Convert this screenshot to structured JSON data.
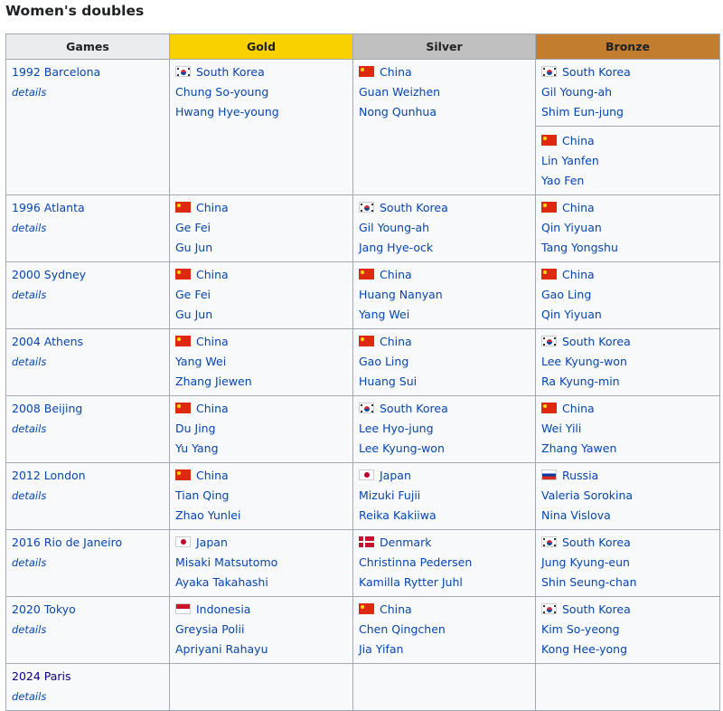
{
  "title": "Women's doubles",
  "headers": {
    "games": "Games",
    "gold": "Gold",
    "silver": "Silver",
    "bronze": "Bronze"
  },
  "details_label": "details",
  "rows": [
    {
      "games": "1992 Barcelona",
      "gold": {
        "country": "South Korea",
        "flag": "kr",
        "players": [
          "Chung So-young",
          "Hwang Hye-young"
        ]
      },
      "silver": {
        "country": "China",
        "flag": "cn",
        "players": [
          "Guan Weizhen",
          "Nong Qunhua"
        ]
      },
      "bronze": {
        "country": "South Korea",
        "flag": "kr",
        "players": [
          "Gil Young-ah",
          "Shim Eun-jung"
        ]
      },
      "bronze2": {
        "country": "China",
        "flag": "cn",
        "players": [
          "Lin Yanfen",
          "Yao Fen"
        ]
      }
    },
    {
      "games": "1996 Atlanta",
      "gold": {
        "country": "China",
        "flag": "cn",
        "players": [
          "Ge Fei",
          "Gu Jun"
        ]
      },
      "silver": {
        "country": "South Korea",
        "flag": "kr",
        "players": [
          "Gil Young-ah",
          "Jang Hye-ock"
        ]
      },
      "bronze": {
        "country": "China",
        "flag": "cn",
        "players": [
          "Qin Yiyuan",
          "Tang Yongshu"
        ]
      }
    },
    {
      "games": "2000 Sydney",
      "gold": {
        "country": "China",
        "flag": "cn",
        "players": [
          "Ge Fei",
          "Gu Jun"
        ]
      },
      "silver": {
        "country": "China",
        "flag": "cn",
        "players": [
          "Huang Nanyan",
          "Yang Wei"
        ]
      },
      "bronze": {
        "country": "China",
        "flag": "cn",
        "players": [
          "Gao Ling",
          "Qin Yiyuan"
        ]
      }
    },
    {
      "games": "2004 Athens",
      "gold": {
        "country": "China",
        "flag": "cn",
        "players": [
          "Yang Wei",
          "Zhang Jiewen"
        ]
      },
      "silver": {
        "country": "China",
        "flag": "cn",
        "players": [
          "Gao Ling",
          "Huang Sui"
        ]
      },
      "bronze": {
        "country": "South Korea",
        "flag": "kr",
        "players": [
          "Lee Kyung-won",
          "Ra Kyung-min"
        ]
      }
    },
    {
      "games": "2008 Beijing",
      "gold": {
        "country": "China",
        "flag": "cn",
        "players": [
          "Du Jing",
          "Yu Yang"
        ]
      },
      "silver": {
        "country": "South Korea",
        "flag": "kr",
        "players": [
          "Lee Hyo-jung",
          "Lee Kyung-won"
        ]
      },
      "bronze": {
        "country": "China",
        "flag": "cn",
        "players": [
          "Wei Yili",
          "Zhang Yawen"
        ]
      }
    },
    {
      "games": "2012 London",
      "gold": {
        "country": "China",
        "flag": "cn",
        "players": [
          "Tian Qing",
          "Zhao Yunlei"
        ]
      },
      "silver": {
        "country": "Japan",
        "flag": "jp",
        "players": [
          "Mizuki Fujii",
          "Reika Kakiiwa"
        ]
      },
      "bronze": {
        "country": "Russia",
        "flag": "ru",
        "players": [
          "Valeria Sorokina",
          "Nina Vislova"
        ]
      }
    },
    {
      "games": "2016 Rio de Janeiro",
      "gold": {
        "country": "Japan",
        "flag": "jp",
        "players": [
          "Misaki Matsutomo",
          "Ayaka Takahashi"
        ]
      },
      "silver": {
        "country": "Denmark",
        "flag": "dk",
        "players": [
          "Christinna Pedersen",
          "Kamilla Rytter Juhl"
        ]
      },
      "bronze": {
        "country": "South Korea",
        "flag": "kr",
        "players": [
          "Jung Kyung-eun",
          "Shin Seung-chan"
        ]
      }
    },
    {
      "games": "2020 Tokyo",
      "gold": {
        "country": "Indonesia",
        "flag": "id",
        "players": [
          "Greysia Polii",
          "Apriyani Rahayu"
        ]
      },
      "silver": {
        "country": "China",
        "flag": "cn",
        "players": [
          "Chen Qingchen",
          "Jia Yifan"
        ]
      },
      "bronze": {
        "country": "South Korea",
        "flag": "kr",
        "players": [
          "Kim So-yeong",
          "Kong Hee-yong"
        ]
      }
    },
    {
      "games": "2024 Paris"
    }
  ],
  "colors": {
    "gold": "#f9d000",
    "silver": "#c0c0c0",
    "bronze": "#c27d2e",
    "header": "#eaecf0",
    "link": "#0645ad",
    "visited_link": "#0b0080"
  }
}
